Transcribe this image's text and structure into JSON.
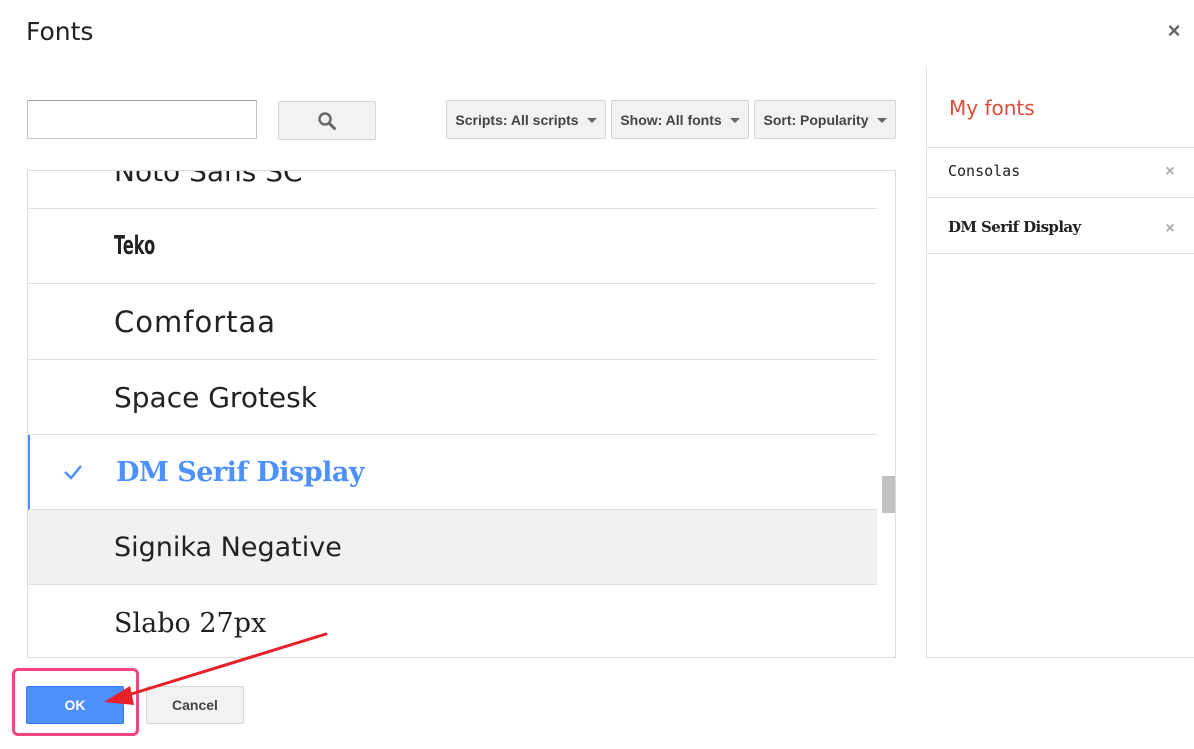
{
  "dialog": {
    "title": "Fonts",
    "close_symbol": "×"
  },
  "search": {
    "value": "",
    "placeholder": ""
  },
  "filters": {
    "scripts_label": "Scripts: All scripts",
    "show_label": "Show: All fonts",
    "sort_label": "Sort: Popularity"
  },
  "font_list": {
    "items": [
      {
        "name": "Noto Sans SC",
        "state": "normal"
      },
      {
        "name": "Teko",
        "state": "normal"
      },
      {
        "name": "Comfortaa",
        "state": "normal"
      },
      {
        "name": "Space Grotesk",
        "state": "normal"
      },
      {
        "name": "DM Serif Display",
        "state": "selected"
      },
      {
        "name": "Signika Negative",
        "state": "hovered"
      },
      {
        "name": "Slabo 27px",
        "state": "normal"
      }
    ]
  },
  "my_fonts": {
    "title": "My fonts",
    "items": [
      {
        "name": "Consolas",
        "remove_symbol": "×"
      },
      {
        "name": "DM Serif Display",
        "remove_symbol": "×"
      }
    ]
  },
  "footer": {
    "ok_label": "OK",
    "cancel_label": "Cancel"
  },
  "colors": {
    "accent_blue": "#4d90fe",
    "my_fonts_red": "#dd4b39",
    "annotation_red": "#e8202a",
    "highlight_pink": "#f2477c"
  }
}
